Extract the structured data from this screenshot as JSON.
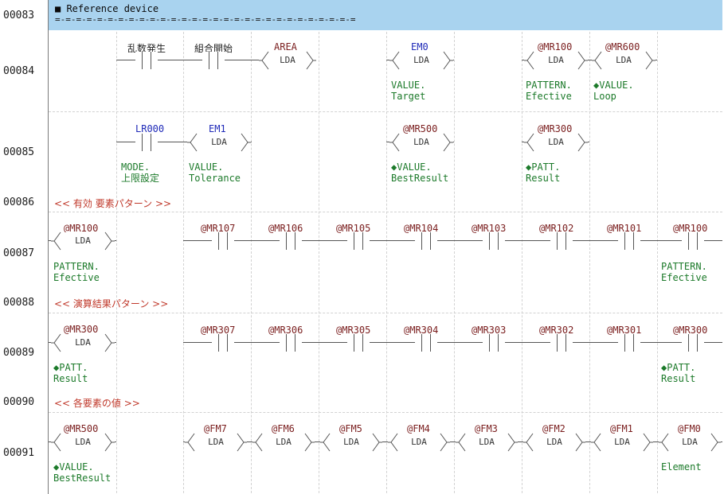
{
  "ref": {
    "title": "■ Reference device",
    "dash": "=-=-=-=-=-=-=-=-=-=-=-=-=-=-=-=-=-=-=-=-=-=-=-=-=-=-=-=-="
  },
  "rows": [
    "00083",
    "00084",
    "00085",
    "00086",
    "00087",
    "00088",
    "00089",
    "00090",
    "00091"
  ],
  "comments": {
    "c86": "<< 有効 要素パターン >>",
    "c88": "<< 演算結果パターン >>",
    "c90": "<< 各要素の値 >>"
  },
  "r84": {
    "c1": "乱数発生",
    "c2": "組合開始",
    "area": "AREA",
    "em0": "EM0",
    "mr100": "@MR100",
    "mr600": "@MR600",
    "lda": "LDA",
    "n1a": "VALUE.",
    "n1b": "Target",
    "n2a": "PATTERN.",
    "n2b": "Efective",
    "n3a": "◆VALUE.",
    "n3b": "Loop"
  },
  "r85": {
    "lr000": "LR000",
    "em1": "EM1",
    "mr500": "@MR500",
    "mr300": "@MR300",
    "lda": "LDA",
    "n1a": "MODE.",
    "n1b": "上限設定",
    "n2a": "VALUE.",
    "n2b": "Tolerance",
    "n3a": "◆VALUE.",
    "n3b": "BestResult",
    "n4a": "◆PATT.",
    "n4b": "Result"
  },
  "r87": {
    "head": "@MR100",
    "lda": "LDA",
    "contacts": [
      "@MR107",
      "@MR106",
      "@MR105",
      "@MR104",
      "@MR103",
      "@MR102",
      "@MR101"
    ],
    "tail": "@MR100",
    "na": "PATTERN.",
    "nb": "Efective",
    "ta": "PATTERN.",
    "tb": "Efective"
  },
  "r89": {
    "head": "@MR300",
    "lda": "LDA",
    "contacts": [
      "@MR307",
      "@MR306",
      "@MR305",
      "@MR304",
      "@MR303",
      "@MR302",
      "@MR301"
    ],
    "tail": "@MR300",
    "na": "◆PATT.",
    "nb": "Result",
    "ta": "◆PATT.",
    "tb": "Result"
  },
  "r91": {
    "head": "@MR500",
    "lda": "LDA",
    "funcs": [
      "@FM7",
      "@FM6",
      "@FM5",
      "@FM4",
      "@FM3",
      "@FM2",
      "@FM1",
      "@FM0"
    ],
    "na": "◆VALUE.",
    "nb": "BestResult",
    "tail_note": "Element"
  }
}
